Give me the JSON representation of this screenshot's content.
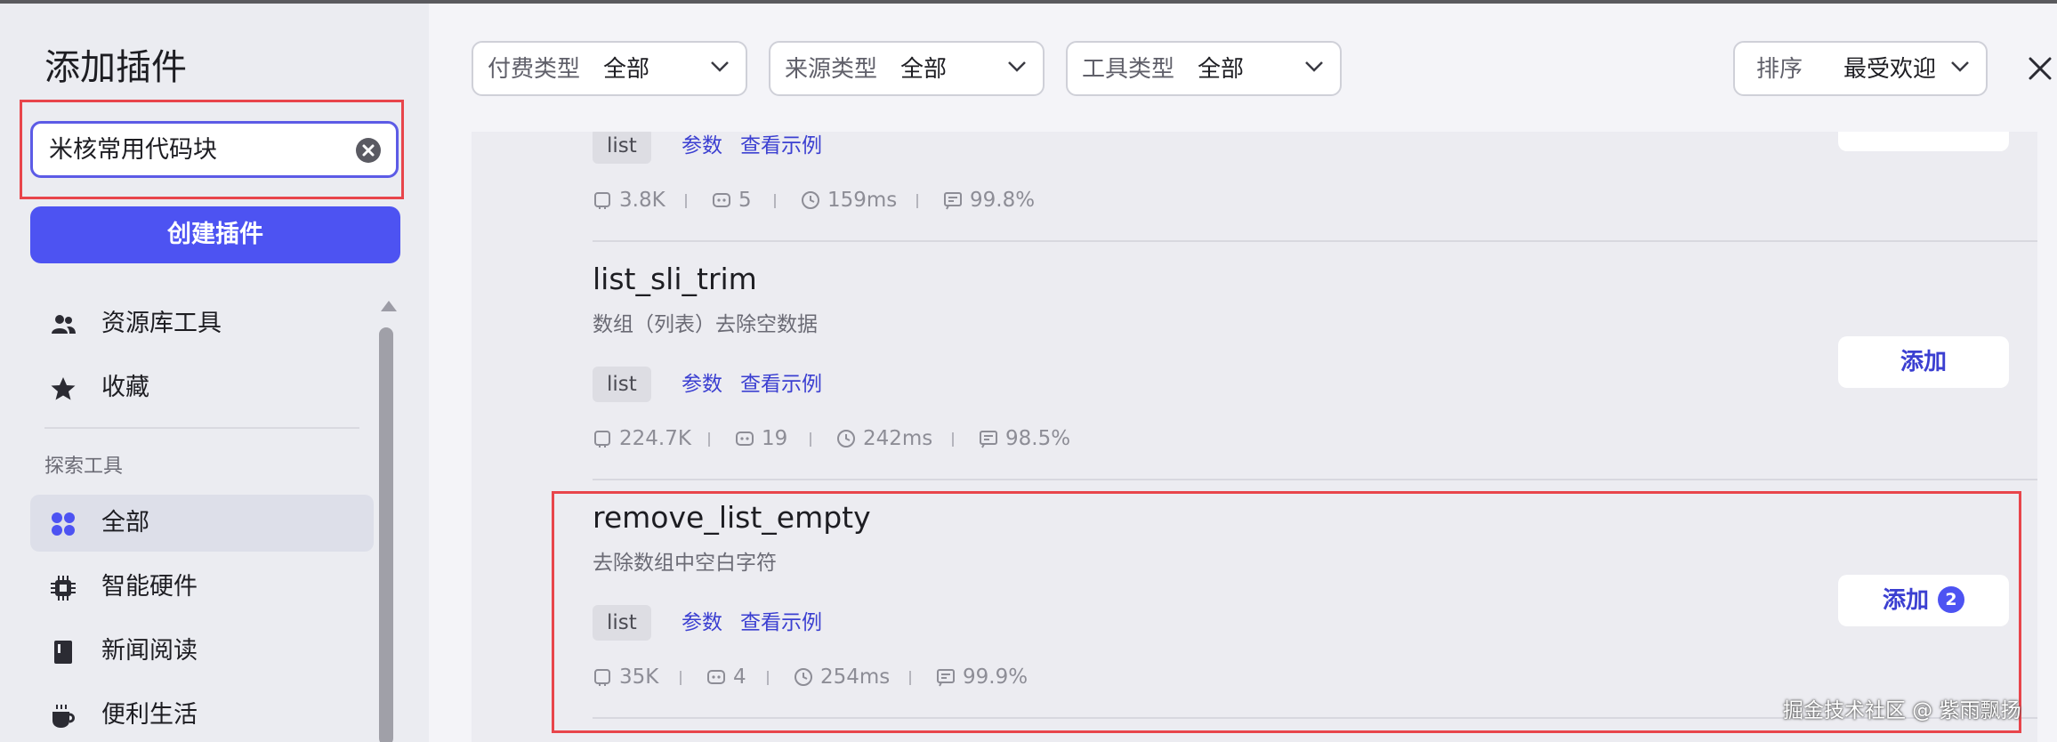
{
  "sidebar": {
    "title": "添加插件",
    "search": {
      "value": "米核常用代码块"
    },
    "create_button": "创建插件",
    "primary_items": [
      {
        "label": "资源库工具",
        "icon": "users-icon"
      },
      {
        "label": "收藏",
        "icon": "star-icon"
      }
    ],
    "section_label": "探索工具",
    "categories": [
      {
        "label": "全部",
        "icon": "grid-icon",
        "active": true
      },
      {
        "label": "智能硬件",
        "icon": "chip-icon",
        "active": false
      },
      {
        "label": "新闻阅读",
        "icon": "book-icon",
        "active": false
      },
      {
        "label": "便利生活",
        "icon": "cup-icon",
        "active": false
      }
    ]
  },
  "filters": {
    "pay_type": {
      "label": "付费类型",
      "value": "全部"
    },
    "source_type": {
      "label": "来源类型",
      "value": "全部"
    },
    "tool_type": {
      "label": "工具类型",
      "value": "全部"
    },
    "sort": {
      "label": "排序",
      "value": "最受欢迎"
    }
  },
  "plugins": [
    {
      "name": "",
      "description": "",
      "tag": "list",
      "params_link": "参数",
      "example_link": "查看示例",
      "stats": {
        "usage": "3.8K",
        "bots": "5",
        "latency": "159ms",
        "success": "99.8%"
      }
    },
    {
      "name": "list_sli_trim",
      "description": "数组（列表）去除空数据",
      "tag": "list",
      "params_link": "参数",
      "example_link": "查看示例",
      "add_label": "添加",
      "stats": {
        "usage": "224.7K",
        "bots": "19",
        "latency": "242ms",
        "success": "98.5%"
      }
    },
    {
      "name": "remove_list_empty",
      "description": "去除数组中空白字符",
      "tag": "list",
      "params_link": "参数",
      "example_link": "查看示例",
      "add_label": "添加",
      "add_count": "2",
      "stats": {
        "usage": "35K",
        "bots": "4",
        "latency": "254ms",
        "success": "99.9%"
      }
    }
  ],
  "watermark": "掘金技术社区 @ 紫雨飘扬",
  "colors": {
    "accent": "#4d53f2",
    "link": "#3b3fd1",
    "highlight_border": "#e8454b"
  }
}
